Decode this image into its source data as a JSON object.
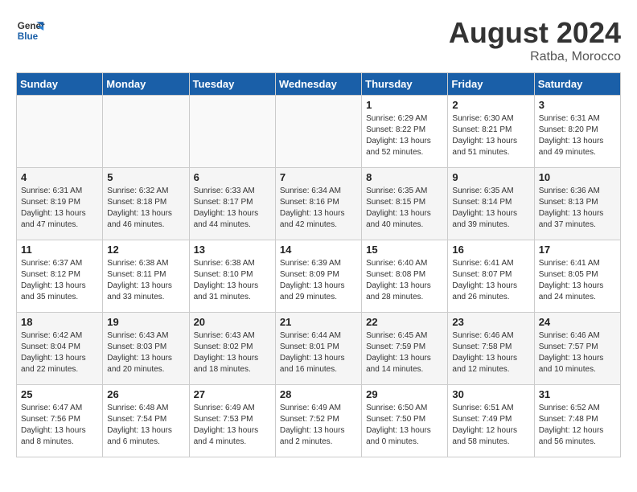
{
  "header": {
    "logo_line1": "General",
    "logo_line2": "Blue",
    "title": "August 2024",
    "location": "Ratba, Morocco"
  },
  "weekdays": [
    "Sunday",
    "Monday",
    "Tuesday",
    "Wednesday",
    "Thursday",
    "Friday",
    "Saturday"
  ],
  "weeks": [
    [
      {
        "day": "",
        "info": ""
      },
      {
        "day": "",
        "info": ""
      },
      {
        "day": "",
        "info": ""
      },
      {
        "day": "",
        "info": ""
      },
      {
        "day": "1",
        "info": "Sunrise: 6:29 AM\nSunset: 8:22 PM\nDaylight: 13 hours\nand 52 minutes."
      },
      {
        "day": "2",
        "info": "Sunrise: 6:30 AM\nSunset: 8:21 PM\nDaylight: 13 hours\nand 51 minutes."
      },
      {
        "day": "3",
        "info": "Sunrise: 6:31 AM\nSunset: 8:20 PM\nDaylight: 13 hours\nand 49 minutes."
      }
    ],
    [
      {
        "day": "4",
        "info": "Sunrise: 6:31 AM\nSunset: 8:19 PM\nDaylight: 13 hours\nand 47 minutes."
      },
      {
        "day": "5",
        "info": "Sunrise: 6:32 AM\nSunset: 8:18 PM\nDaylight: 13 hours\nand 46 minutes."
      },
      {
        "day": "6",
        "info": "Sunrise: 6:33 AM\nSunset: 8:17 PM\nDaylight: 13 hours\nand 44 minutes."
      },
      {
        "day": "7",
        "info": "Sunrise: 6:34 AM\nSunset: 8:16 PM\nDaylight: 13 hours\nand 42 minutes."
      },
      {
        "day": "8",
        "info": "Sunrise: 6:35 AM\nSunset: 8:15 PM\nDaylight: 13 hours\nand 40 minutes."
      },
      {
        "day": "9",
        "info": "Sunrise: 6:35 AM\nSunset: 8:14 PM\nDaylight: 13 hours\nand 39 minutes."
      },
      {
        "day": "10",
        "info": "Sunrise: 6:36 AM\nSunset: 8:13 PM\nDaylight: 13 hours\nand 37 minutes."
      }
    ],
    [
      {
        "day": "11",
        "info": "Sunrise: 6:37 AM\nSunset: 8:12 PM\nDaylight: 13 hours\nand 35 minutes."
      },
      {
        "day": "12",
        "info": "Sunrise: 6:38 AM\nSunset: 8:11 PM\nDaylight: 13 hours\nand 33 minutes."
      },
      {
        "day": "13",
        "info": "Sunrise: 6:38 AM\nSunset: 8:10 PM\nDaylight: 13 hours\nand 31 minutes."
      },
      {
        "day": "14",
        "info": "Sunrise: 6:39 AM\nSunset: 8:09 PM\nDaylight: 13 hours\nand 29 minutes."
      },
      {
        "day": "15",
        "info": "Sunrise: 6:40 AM\nSunset: 8:08 PM\nDaylight: 13 hours\nand 28 minutes."
      },
      {
        "day": "16",
        "info": "Sunrise: 6:41 AM\nSunset: 8:07 PM\nDaylight: 13 hours\nand 26 minutes."
      },
      {
        "day": "17",
        "info": "Sunrise: 6:41 AM\nSunset: 8:05 PM\nDaylight: 13 hours\nand 24 minutes."
      }
    ],
    [
      {
        "day": "18",
        "info": "Sunrise: 6:42 AM\nSunset: 8:04 PM\nDaylight: 13 hours\nand 22 minutes."
      },
      {
        "day": "19",
        "info": "Sunrise: 6:43 AM\nSunset: 8:03 PM\nDaylight: 13 hours\nand 20 minutes."
      },
      {
        "day": "20",
        "info": "Sunrise: 6:43 AM\nSunset: 8:02 PM\nDaylight: 13 hours\nand 18 minutes."
      },
      {
        "day": "21",
        "info": "Sunrise: 6:44 AM\nSunset: 8:01 PM\nDaylight: 13 hours\nand 16 minutes."
      },
      {
        "day": "22",
        "info": "Sunrise: 6:45 AM\nSunset: 7:59 PM\nDaylight: 13 hours\nand 14 minutes."
      },
      {
        "day": "23",
        "info": "Sunrise: 6:46 AM\nSunset: 7:58 PM\nDaylight: 13 hours\nand 12 minutes."
      },
      {
        "day": "24",
        "info": "Sunrise: 6:46 AM\nSunset: 7:57 PM\nDaylight: 13 hours\nand 10 minutes."
      }
    ],
    [
      {
        "day": "25",
        "info": "Sunrise: 6:47 AM\nSunset: 7:56 PM\nDaylight: 13 hours\nand 8 minutes."
      },
      {
        "day": "26",
        "info": "Sunrise: 6:48 AM\nSunset: 7:54 PM\nDaylight: 13 hours\nand 6 minutes."
      },
      {
        "day": "27",
        "info": "Sunrise: 6:49 AM\nSunset: 7:53 PM\nDaylight: 13 hours\nand 4 minutes."
      },
      {
        "day": "28",
        "info": "Sunrise: 6:49 AM\nSunset: 7:52 PM\nDaylight: 13 hours\nand 2 minutes."
      },
      {
        "day": "29",
        "info": "Sunrise: 6:50 AM\nSunset: 7:50 PM\nDaylight: 13 hours\nand 0 minutes."
      },
      {
        "day": "30",
        "info": "Sunrise: 6:51 AM\nSunset: 7:49 PM\nDaylight: 12 hours\nand 58 minutes."
      },
      {
        "day": "31",
        "info": "Sunrise: 6:52 AM\nSunset: 7:48 PM\nDaylight: 12 hours\nand 56 minutes."
      }
    ]
  ]
}
